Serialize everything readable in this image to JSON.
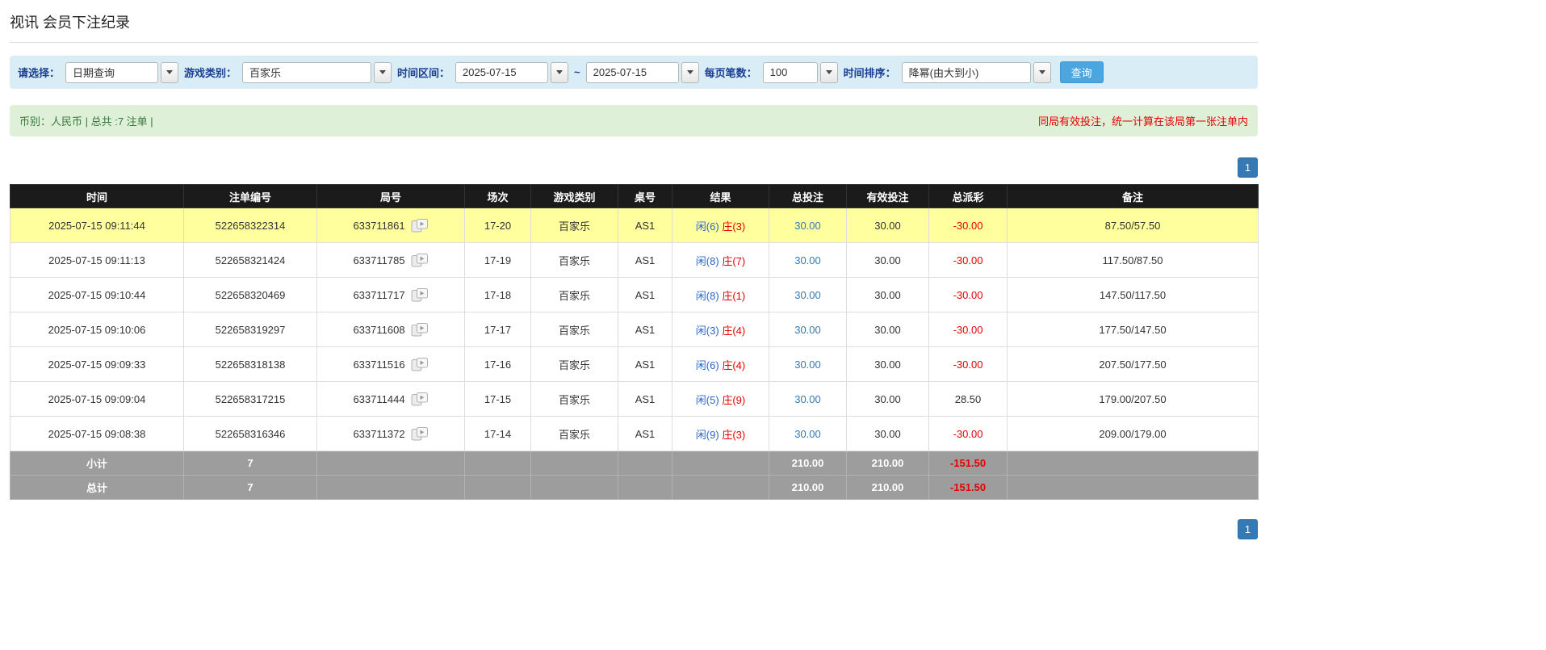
{
  "page": {
    "title": "视讯 会员下注纪录"
  },
  "colors": {
    "filter_bar_bg": "#d9edf7",
    "summary_bar_bg": "#dff0d8",
    "summary_text_green": "#3c763d",
    "notice_red": "#e60000",
    "header_black": "#1b1b1b",
    "highlight_yellow": "#ffff9e",
    "summary_row_gray": "#9d9d9d",
    "link_blue": "#337ab7",
    "player_blue": "#2a66c8",
    "banker_red": "#e60000",
    "search_button_blue": "#4ba6df"
  },
  "filters": {
    "select_label": "请选择：",
    "select_value": "日期查询",
    "game_type_label": "游戏类别：",
    "game_type_value": "百家乐",
    "date_range_label": "时间区间：",
    "date_from": "2025-07-15",
    "range_separator": "~",
    "date_to": "2025-07-15",
    "page_size_label": "每页笔数：",
    "page_size_value": "100",
    "sort_label": "时间排序：",
    "sort_value": "降幂(由大到小)",
    "search_button": "查询"
  },
  "summary_bar": {
    "left": "币别：人民币 | 总共 :7 注单 |",
    "right": "同局有效投注，统一计算在该局第一张注单内"
  },
  "pagination": {
    "current_page": "1"
  },
  "table": {
    "headers": [
      "时间",
      "注单编号",
      "局号",
      "场次",
      "游戏类别",
      "桌号",
      "结果",
      "总投注",
      "有效投注",
      "总派彩",
      "备注"
    ],
    "rows": [
      {
        "time": "2025-07-15 09:11:44",
        "bet_id": "522658322314",
        "round_id": "633711861",
        "session": "17-20",
        "game": "百家乐",
        "table_no": "AS1",
        "result_xian": "闲(6)",
        "result_zhuang": "庄(3)",
        "total_bet": "30.00",
        "valid_bet": "30.00",
        "payout": "-30.00",
        "remark": "87.50/57.50"
      },
      {
        "time": "2025-07-15 09:11:13",
        "bet_id": "522658321424",
        "round_id": "633711785",
        "session": "17-19",
        "game": "百家乐",
        "table_no": "AS1",
        "result_xian": "闲(8)",
        "result_zhuang": "庄(7)",
        "total_bet": "30.00",
        "valid_bet": "30.00",
        "payout": "-30.00",
        "remark": "117.50/87.50"
      },
      {
        "time": "2025-07-15 09:10:44",
        "bet_id": "522658320469",
        "round_id": "633711717",
        "session": "17-18",
        "game": "百家乐",
        "table_no": "AS1",
        "result_xian": "闲(8)",
        "result_zhuang": "庄(1)",
        "total_bet": "30.00",
        "valid_bet": "30.00",
        "payout": "-30.00",
        "remark": "147.50/117.50"
      },
      {
        "time": "2025-07-15 09:10:06",
        "bet_id": "522658319297",
        "round_id": "633711608",
        "session": "17-17",
        "game": "百家乐",
        "table_no": "AS1",
        "result_xian": "闲(3)",
        "result_zhuang": "庄(4)",
        "total_bet": "30.00",
        "valid_bet": "30.00",
        "payout": "-30.00",
        "remark": "177.50/147.50"
      },
      {
        "time": "2025-07-15 09:09:33",
        "bet_id": "522658318138",
        "round_id": "633711516",
        "session": "17-16",
        "game": "百家乐",
        "table_no": "AS1",
        "result_xian": "闲(6)",
        "result_zhuang": "庄(4)",
        "total_bet": "30.00",
        "valid_bet": "30.00",
        "payout": "-30.00",
        "remark": "207.50/177.50"
      },
      {
        "time": "2025-07-15 09:09:04",
        "bet_id": "522658317215",
        "round_id": "633711444",
        "session": "17-15",
        "game": "百家乐",
        "table_no": "AS1",
        "result_xian": "闲(5)",
        "result_zhuang": "庄(9)",
        "total_bet": "30.00",
        "valid_bet": "30.00",
        "payout": "28.50",
        "remark": "179.00/207.50"
      },
      {
        "time": "2025-07-15 09:08:38",
        "bet_id": "522658316346",
        "round_id": "633711372",
        "session": "17-14",
        "game": "百家乐",
        "table_no": "AS1",
        "result_xian": "闲(9)",
        "result_zhuang": "庄(3)",
        "total_bet": "30.00",
        "valid_bet": "30.00",
        "payout": "-30.00",
        "remark": "209.00/179.00"
      }
    ],
    "subtotal": {
      "label": "小计",
      "count": "7",
      "total_bet": "210.00",
      "valid_bet": "210.00",
      "payout": "-151.50"
    },
    "total": {
      "label": "总计",
      "count": "7",
      "total_bet": "210.00",
      "valid_bet": "210.00",
      "payout": "-151.50"
    }
  }
}
